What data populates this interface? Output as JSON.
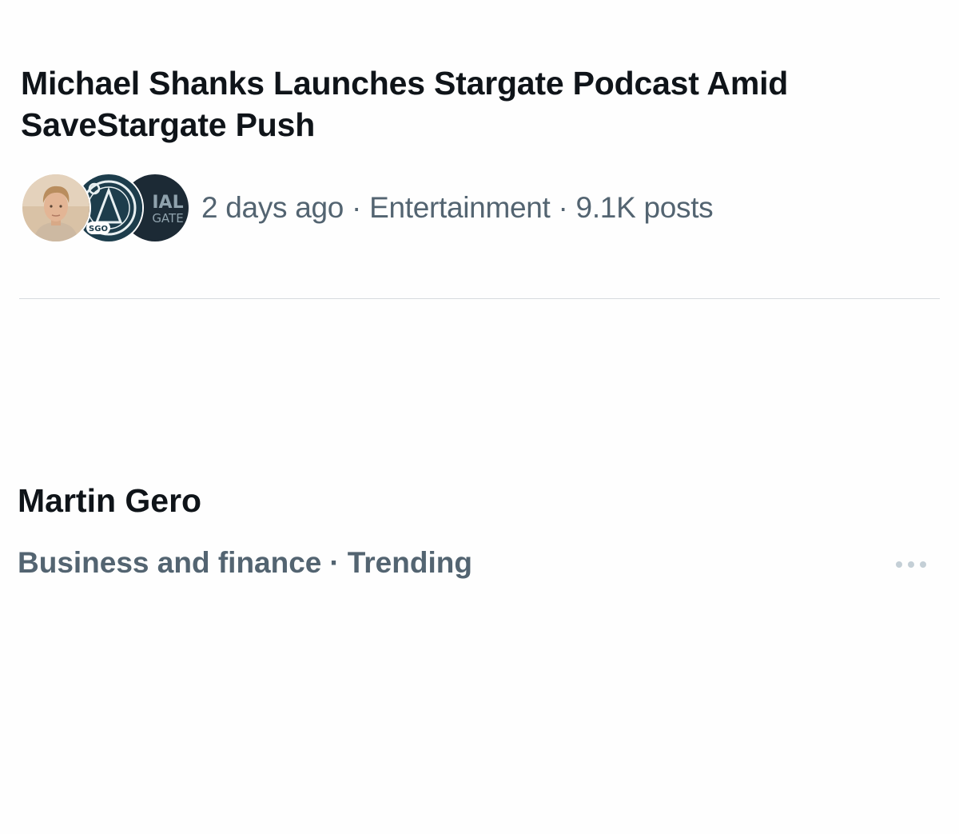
{
  "story": {
    "title": "Michael Shanks Launches Stargate Podcast Amid SaveStargate Push",
    "time": "2 days ago",
    "separator": "·",
    "category": "Entertainment",
    "post_count": "9.1K posts",
    "avatars": [
      {
        "icon": "person-photo"
      },
      {
        "icon": "sgo-logo",
        "text": "SGO"
      },
      {
        "icon": "stargate-logo",
        "text_1": "IAL",
        "text_2": "GATE"
      }
    ]
  },
  "trend": {
    "name": "Martin Gero",
    "category": "Business and finance",
    "separator": "·",
    "status": "Trending",
    "more_icon": "more-horizontal"
  },
  "colors": {
    "primary_text": "#0f1419",
    "secondary_text": "#536471",
    "divider": "#d7dbde",
    "more_icon": "#c4cfd6"
  }
}
